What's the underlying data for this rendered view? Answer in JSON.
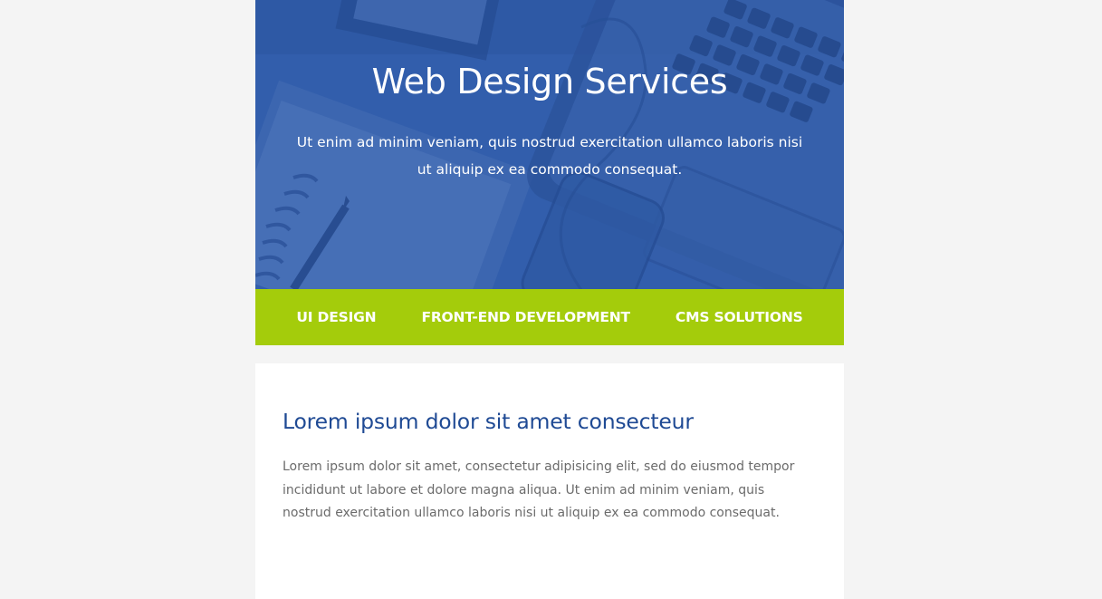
{
  "colors": {
    "page_bg": "#f4f4f4",
    "hero_blue": "#3461ad",
    "nav_green": "#a4cc0b",
    "heading_blue": "#1f4a94",
    "body_text": "#6b6b6b"
  },
  "hero": {
    "title": "Web Design Services",
    "subtitle": "Ut enim ad minim veniam, quis nostrud exercitation ullamco laboris nisi ut aliquip ex ea commodo consequat."
  },
  "nav": {
    "items": [
      {
        "label": "UI DESIGN"
      },
      {
        "label": "FRONT-END DEVELOPMENT"
      },
      {
        "label": "CMS SOLUTIONS"
      }
    ]
  },
  "content": {
    "heading": "Lorem ipsum dolor sit amet consecteur",
    "body": "Lorem ipsum dolor sit amet, consectetur adipisicing elit, sed do eiusmod tempor incididunt ut labore et dolore magna aliqua. Ut enim ad minim veniam, quis nostrud exercitation ullamco laboris nisi ut aliquip ex ea commodo consequat."
  }
}
